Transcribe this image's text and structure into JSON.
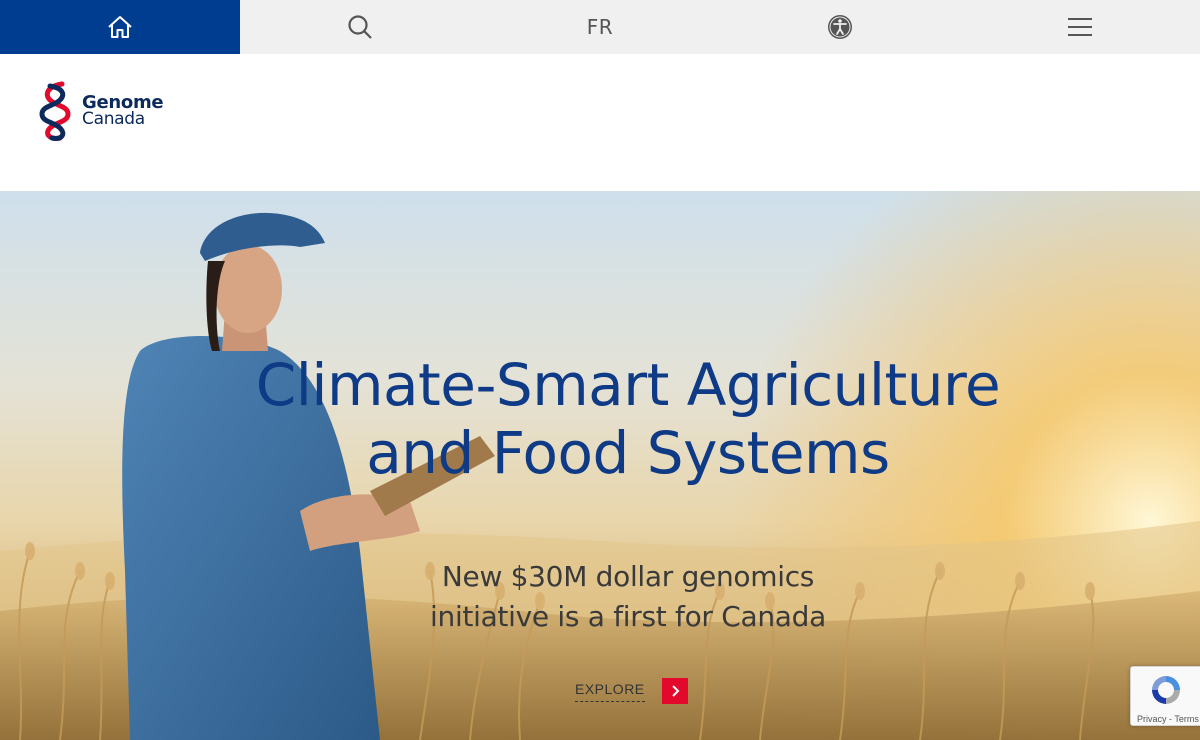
{
  "nav": {
    "home_icon": "home-icon",
    "search_icon": "search-icon",
    "language_label": "FR",
    "accessibility_icon": "accessibility-icon",
    "menu_icon": "hamburger-menu-icon",
    "active_color": "#003c8f"
  },
  "logo": {
    "line1": "Genome",
    "line2": "Canada",
    "brand_red": "#e3092d",
    "brand_navy": "#0d2a5c"
  },
  "hero": {
    "title_line1": "Climate-Smart Agriculture",
    "title_line2": "and Food Systems",
    "subtitle_line1": "New $30M dollar genomics",
    "subtitle_line2": "initiative is a first for Canada",
    "cta_label": "EXPLORE",
    "cta_icon": "chevron-right-icon",
    "title_color": "#0e3a86"
  },
  "recaptcha": {
    "links": "Privacy - Terms"
  }
}
